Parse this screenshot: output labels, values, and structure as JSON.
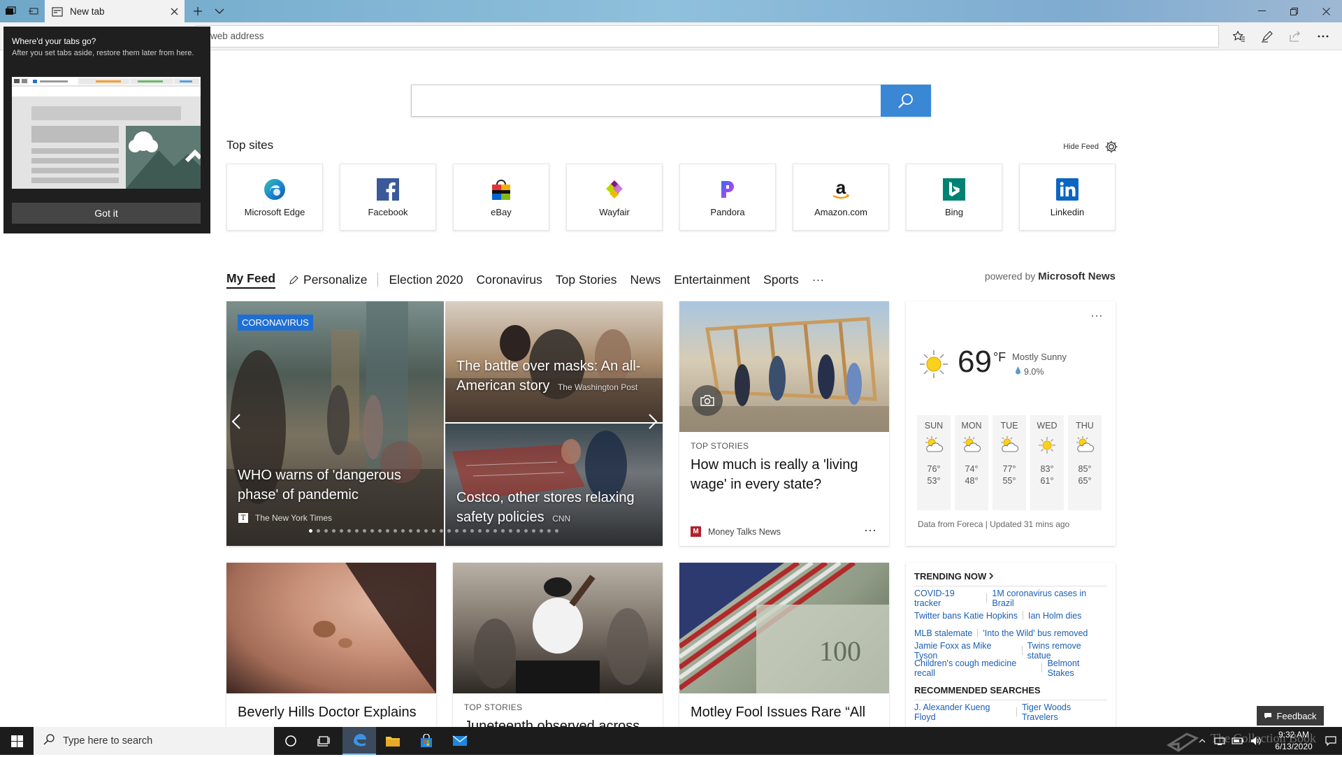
{
  "browser": {
    "tab_title": "New tab",
    "address_placeholder": "web address"
  },
  "flyout": {
    "title": "Where'd your tabs go?",
    "body": "After you set tabs aside, restore them later from here.",
    "button": "Got it"
  },
  "search": {
    "placeholder": ""
  },
  "top_sites": {
    "label": "Top sites",
    "hide_feed": "Hide Feed",
    "items": [
      {
        "label": "Microsoft Edge",
        "icon": "edge-icon"
      },
      {
        "label": "Facebook",
        "icon": "facebook-icon"
      },
      {
        "label": "eBay",
        "icon": "ebay-icon"
      },
      {
        "label": "Wayfair",
        "icon": "wayfair-icon"
      },
      {
        "label": "Pandora",
        "icon": "pandora-icon"
      },
      {
        "label": "Amazon.com",
        "icon": "amazon-icon"
      },
      {
        "label": "Bing",
        "icon": "bing-icon"
      },
      {
        "label": "Linkedin",
        "icon": "linkedin-icon"
      }
    ]
  },
  "feed_nav": {
    "items": [
      "My Feed",
      "Personalize",
      "Election 2020",
      "Coronavirus",
      "Top Stories",
      "News",
      "Entertainment",
      "Sports",
      "···"
    ],
    "powered_prefix": "powered by",
    "powered_brand": "Microsoft News"
  },
  "carousel": {
    "badge": "CORONAVIRUS",
    "main_title": "WHO warns of 'dangerous phase' of pandemic",
    "main_source": "The New York Times",
    "story2_title": "The battle over masks: An all-American story",
    "story2_source": "The Washington Post",
    "story3_title": "Costco, other stores relaxing safety policies",
    "story3_source": "CNN"
  },
  "story_wage": {
    "tag": "TOP STORIES",
    "title": "How much is really a 'living wage' in every state?",
    "source": "Money Talks News",
    "more": "···"
  },
  "weather": {
    "temp": "69",
    "unit": "°F",
    "condition": "Mostly Sunny",
    "precip": "9.0%",
    "more": "···",
    "days": [
      {
        "day": "SUN",
        "hi": "76°",
        "lo": "53°",
        "icon": "partly-cloudy-icon"
      },
      {
        "day": "MON",
        "hi": "74°",
        "lo": "48°",
        "icon": "partly-cloudy-icon"
      },
      {
        "day": "TUE",
        "hi": "77°",
        "lo": "55°",
        "icon": "partly-cloudy-icon"
      },
      {
        "day": "WED",
        "hi": "83°",
        "lo": "61°",
        "icon": "sun-icon"
      },
      {
        "day": "THU",
        "hi": "85°",
        "lo": "65°",
        "icon": "partly-cloudy-icon"
      }
    ],
    "footer": "Data from Foreca | Updated 31 mins ago"
  },
  "trending": {
    "title": "TRENDING NOW",
    "rows": [
      [
        "COVID-19 tracker",
        "1M coronavirus cases in Brazil"
      ],
      [
        "Twitter bans Katie Hopkins",
        "Ian Holm dies"
      ],
      [
        "MLB stalemate",
        "'Into the Wild' bus removed"
      ],
      [
        "Jamie Foxx as Mike Tyson",
        "Twins remove statue"
      ],
      [
        "Children's cough medicine recall",
        "Belmont Stakes"
      ]
    ],
    "recommended_title": "RECOMMENDED SEARCHES",
    "recommended": [
      "J. Alexander Kueng Floyd",
      "Tiger Woods Travelers"
    ]
  },
  "row2": {
    "card1_title": "Beverly Hills Doctor Explains",
    "card2_tag": "TOP STORIES",
    "card2_title": "Juneteenth observed across",
    "card3_title": "Motley Fool Issues Rare “All"
  },
  "feedback": "Feedback",
  "taskbar": {
    "search_placeholder": "Type here to search",
    "time": "9:32 AM",
    "date": "6/13/2020",
    "watermark": "The Collection Book"
  }
}
